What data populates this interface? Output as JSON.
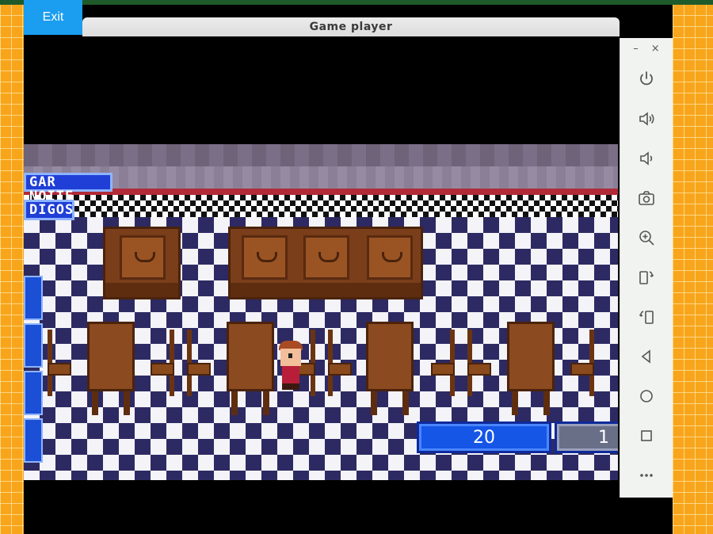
{
  "window": {
    "title": "Game player",
    "exit_label": "Exit"
  },
  "game": {
    "sign_top": "GAR NOITE",
    "sign_bottom": "DIGOS",
    "score_left": "20",
    "score_right": "1"
  },
  "emulator_toolbar": {
    "minimize_label": "–",
    "close_label": "×",
    "buttons": [
      "power-icon",
      "volume-up-icon",
      "volume-down-icon",
      "camera-icon",
      "zoom-in-icon",
      "rotate-left-icon",
      "rotate-right-icon",
      "back-icon",
      "home-icon",
      "recents-icon",
      "more-icon"
    ]
  },
  "colors": {
    "accent_blue": "#1b9df0",
    "side_orange": "#f8a51c",
    "top_strip": "#1f5a2a"
  }
}
